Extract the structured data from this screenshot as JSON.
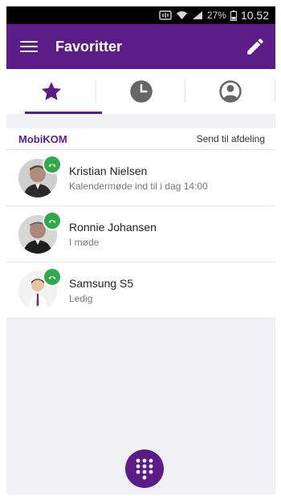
{
  "status_bar": {
    "battery": "27%",
    "time": "10.52"
  },
  "app_bar": {
    "title": "Favoritter",
    "menu_icon": "hamburger-menu-icon",
    "edit_icon": "pencil-icon"
  },
  "tabs": [
    {
      "icon": "star-icon",
      "selected": true
    },
    {
      "icon": "clock-icon",
      "selected": false
    },
    {
      "icon": "person-icon",
      "selected": false
    }
  ],
  "section": {
    "title": "MobiKOM",
    "action": "Send til afdeling"
  },
  "contacts": [
    {
      "name": "Kristian Nielsen",
      "status": "Kalendermøde ind til i dag 14:00",
      "presence_icon": "phone-icon"
    },
    {
      "name": "Ronnie Johansen",
      "status": "I møde",
      "presence_icon": "phone-icon"
    },
    {
      "name": "Samsung S5",
      "status": "Ledig",
      "presence_icon": "phone-icon"
    }
  ],
  "fab": {
    "icon": "dialpad-icon"
  },
  "colors": {
    "brand": "#5c1c87",
    "presence_available": "#2eaa4a",
    "background": "#f1f0f5"
  }
}
